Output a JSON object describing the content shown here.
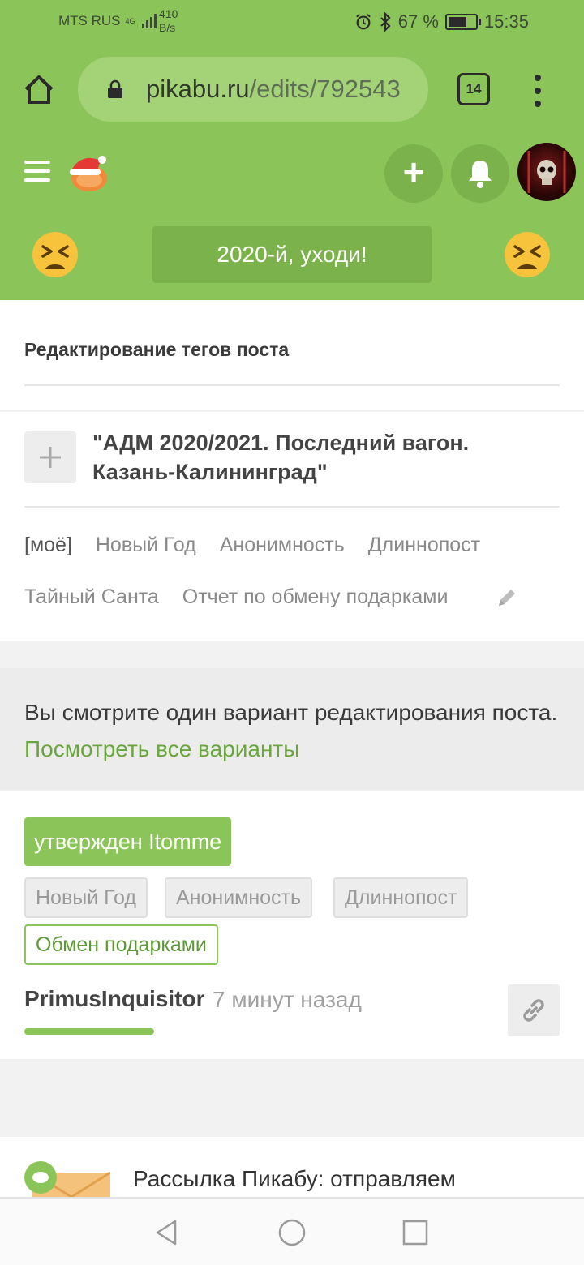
{
  "status_bar": {
    "carrier": "MTS RUS",
    "network": "4G",
    "speed_value": "410",
    "speed_unit": "B/s",
    "battery": "67 %",
    "time": "15:35"
  },
  "browser": {
    "url_domain": "pikabu.ru",
    "url_path": "/edits/792543",
    "tab_count": "14"
  },
  "header": {
    "banner_text": "2020-й, уходи!"
  },
  "section": {
    "title": "Редактирование тегов поста"
  },
  "post": {
    "title": "\"АДМ 2020/2021. Последний вагон. Казань-Калининград\"",
    "tags_row1": [
      "[моё]",
      "Новый Год",
      "Анонимность",
      "Длиннопост"
    ],
    "tags_row2": [
      "Тайный Санта",
      "Отчет по обмену подарками"
    ]
  },
  "info": {
    "text": "Вы смотрите один вариант редактирования поста.",
    "link": "Посмотреть все варианты"
  },
  "edit": {
    "status": "утвержден Itomme",
    "old_tags": [
      "Новый Год",
      "Анонимность",
      "Длиннопост"
    ],
    "new_tag": "Обмен подарками",
    "author": "PrimusInquisitor",
    "time": "7 минут назад"
  },
  "news": {
    "text": "Рассылка Пикабу: отправляем"
  },
  "colors": {
    "brand_green": "#8bc55a",
    "link_green": "#6aa53d"
  }
}
